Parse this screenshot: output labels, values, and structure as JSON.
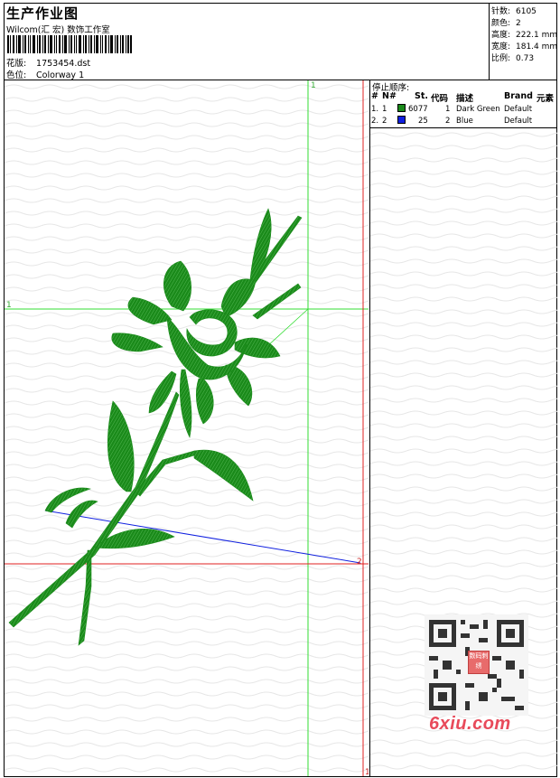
{
  "header": {
    "title": "生产作业图",
    "studio": "Wilcom(汇 宏) 数饰工作室",
    "design_label": "花版:",
    "design_value": "1753454.dst",
    "color_label": "色位:",
    "color_value": "Colorway 1"
  },
  "specs": [
    {
      "label": "针数:",
      "value": "6105"
    },
    {
      "label": "颜色:",
      "value": "2"
    },
    {
      "label": "高度:",
      "value": "222.1 mm"
    },
    {
      "label": "宽度:",
      "value": "181.4 mm"
    },
    {
      "label": "比例:",
      "value": "0.73"
    }
  ],
  "stop_sequence": {
    "title": "停止顺序:",
    "columns": [
      "#",
      "N#",
      "St.",
      "代码",
      "描述",
      "Brand",
      "元素"
    ],
    "rows": [
      {
        "idx": "1.",
        "n": "1",
        "st": "6077",
        "code": "1",
        "desc": "Dark Green",
        "brand": "Default",
        "color": "#1a8a1a"
      },
      {
        "idx": "2.",
        "n": "2",
        "st": "25",
        "code": "2",
        "desc": "Blue",
        "brand": "Default",
        "color": "#1020e0"
      }
    ]
  },
  "canvas_markers": {
    "top_marker": "1",
    "left_marker": "1",
    "end_marker": "2",
    "bottom_marker": "1"
  },
  "watermark": {
    "site": "6xiu.com",
    "stamp_text": "数码刺绣"
  },
  "colors": {
    "guide_green": "#33dd33",
    "guide_red": "#e02020",
    "thread_green": "#1a8a1a",
    "thread_blue": "#1020e0",
    "watermark_red": "#e84a5a"
  }
}
